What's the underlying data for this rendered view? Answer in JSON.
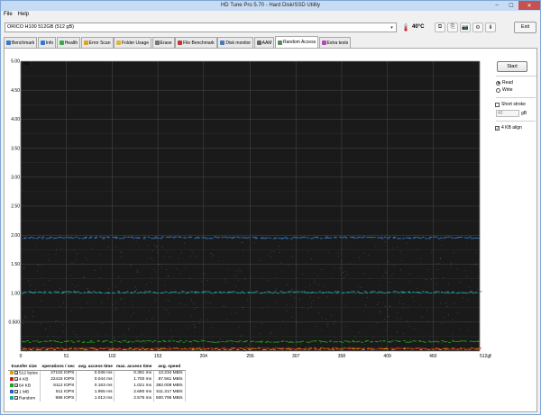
{
  "window": {
    "title": "HD Tune Pro 5.70 - Hard Disk/SSD Utility",
    "minimize": "–",
    "maximize": "☐",
    "close": "✕"
  },
  "menu": {
    "items": [
      {
        "label": "File"
      },
      {
        "label": "Help"
      }
    ]
  },
  "toolbar": {
    "drive": "ORICO H100 512GB (512 gB)",
    "dropdown_arrow": "▾",
    "temperature": "40°C",
    "exit_label": "Exit",
    "icons": [
      {
        "name": "copy-icon",
        "glyph": "⧉"
      },
      {
        "name": "copy-info-icon",
        "glyph": "⎘"
      },
      {
        "name": "camera-icon",
        "glyph": "📷"
      },
      {
        "name": "options-icon",
        "glyph": "⚙"
      },
      {
        "name": "download-icon",
        "glyph": "⬇"
      }
    ]
  },
  "tabs": [
    {
      "label": "Benchmark",
      "icon": "benchmark-icon",
      "color": "#3a78c2",
      "active": false
    },
    {
      "label": "Info",
      "icon": "info-icon",
      "color": "#2e7bd1",
      "active": false
    },
    {
      "label": "Health",
      "icon": "health-icon",
      "color": "#3aa84a",
      "active": false
    },
    {
      "label": "Error Scan",
      "icon": "error-scan-icon",
      "color": "#d8a42a",
      "active": false
    },
    {
      "label": "Folder Usage",
      "icon": "folder-icon",
      "color": "#e0b53a",
      "active": false
    },
    {
      "label": "Erase",
      "icon": "erase-icon",
      "color": "#777777",
      "active": false
    },
    {
      "label": "File Benchmark",
      "icon": "file-benchmark-icon",
      "color": "#c0392b",
      "active": false
    },
    {
      "label": "Disk monitor",
      "icon": "disk-monitor-icon",
      "color": "#4a7ab5",
      "active": false
    },
    {
      "label": "AAM",
      "icon": "aam-icon",
      "color": "#666666",
      "active": false
    },
    {
      "label": "Random Access",
      "icon": "random-access-icon",
      "color": "#5a8a5a",
      "active": true
    },
    {
      "label": "Extra tests",
      "icon": "extra-tests-icon",
      "color": "#b04ab0",
      "active": false
    }
  ],
  "side_panel": {
    "start_label": "Start",
    "read_label": "Read",
    "write_label": "Write",
    "read_selected": true,
    "short_stroke_label": "Short stroke",
    "short_stroke_checked": false,
    "stroke_value": "40",
    "stroke_unit": "gB",
    "align_label": "4 KB align",
    "align_checked": true,
    "check_mark": "✓"
  },
  "results": {
    "headers": [
      "transfer size",
      "operations / sec",
      "avg. access time",
      "max. access time",
      "avg. speed"
    ],
    "rows": [
      {
        "color": "#d8a400",
        "size": "512 bytes",
        "ops": "27102 IOPS",
        "avg": "0.036 ms",
        "max": "0.391 ms",
        "speed": "13.234 MB/s"
      },
      {
        "color": "#c02020",
        "size": "4 KB",
        "ops": "22415 IOPS",
        "avg": "0.044 ms",
        "max": "1.700 ms",
        "speed": "87.561 MB/s"
      },
      {
        "color": "#20a020",
        "size": "64 KB",
        "ops": "6112 IOPS",
        "avg": "0.163 ms",
        "max": "1.021 ms",
        "speed": "382.008 MB/s"
      },
      {
        "color": "#2060c0",
        "size": "1 MB",
        "ops": "511 IOPS",
        "avg": "1.955 ms",
        "max": "2.690 ms",
        "speed": "511.317 MB/s"
      },
      {
        "color": "#20a0a0",
        "size": "Random",
        "ops": "986 IOPS",
        "avg": "1.013 ms",
        "max": "2.575 ms",
        "speed": "500.795 MB/s"
      }
    ]
  },
  "chart_data": {
    "type": "scatter",
    "ylabel": "ms",
    "xlabel": "",
    "x_unit": "gB",
    "xlim": [
      0,
      512
    ],
    "ylim": [
      0,
      5.0
    ],
    "y_ticks": [
      "5.00",
      "4.50",
      "4.00",
      "3.50",
      "3.00",
      "2.50",
      "2.00",
      "1.50",
      "1.00",
      "0.500"
    ],
    "y_tick_values": [
      5.0,
      4.5,
      4.0,
      3.5,
      3.0,
      2.5,
      2.0,
      1.5,
      1.0,
      0.5
    ],
    "x_ticks": [
      "0",
      "51",
      "102",
      "153",
      "204",
      "256",
      "307",
      "358",
      "409",
      "460",
      "512gB"
    ],
    "x_tick_values": [
      0,
      51,
      102,
      153,
      204,
      256,
      307,
      358,
      409,
      460,
      512
    ],
    "grid": true,
    "background": "#1a1a1a",
    "series": [
      {
        "name": "512 bytes",
        "color": "#d8a400",
        "level": 0.036
      },
      {
        "name": "4 KB",
        "color": "#c02020",
        "level": 0.044
      },
      {
        "name": "64 KB",
        "color": "#20a020",
        "level": 0.163
      },
      {
        "name": "1 MB",
        "color": "#2f7fd0",
        "level": 1.955
      },
      {
        "name": "Random",
        "color": "#20a0a0",
        "level": 1.013
      }
    ]
  }
}
